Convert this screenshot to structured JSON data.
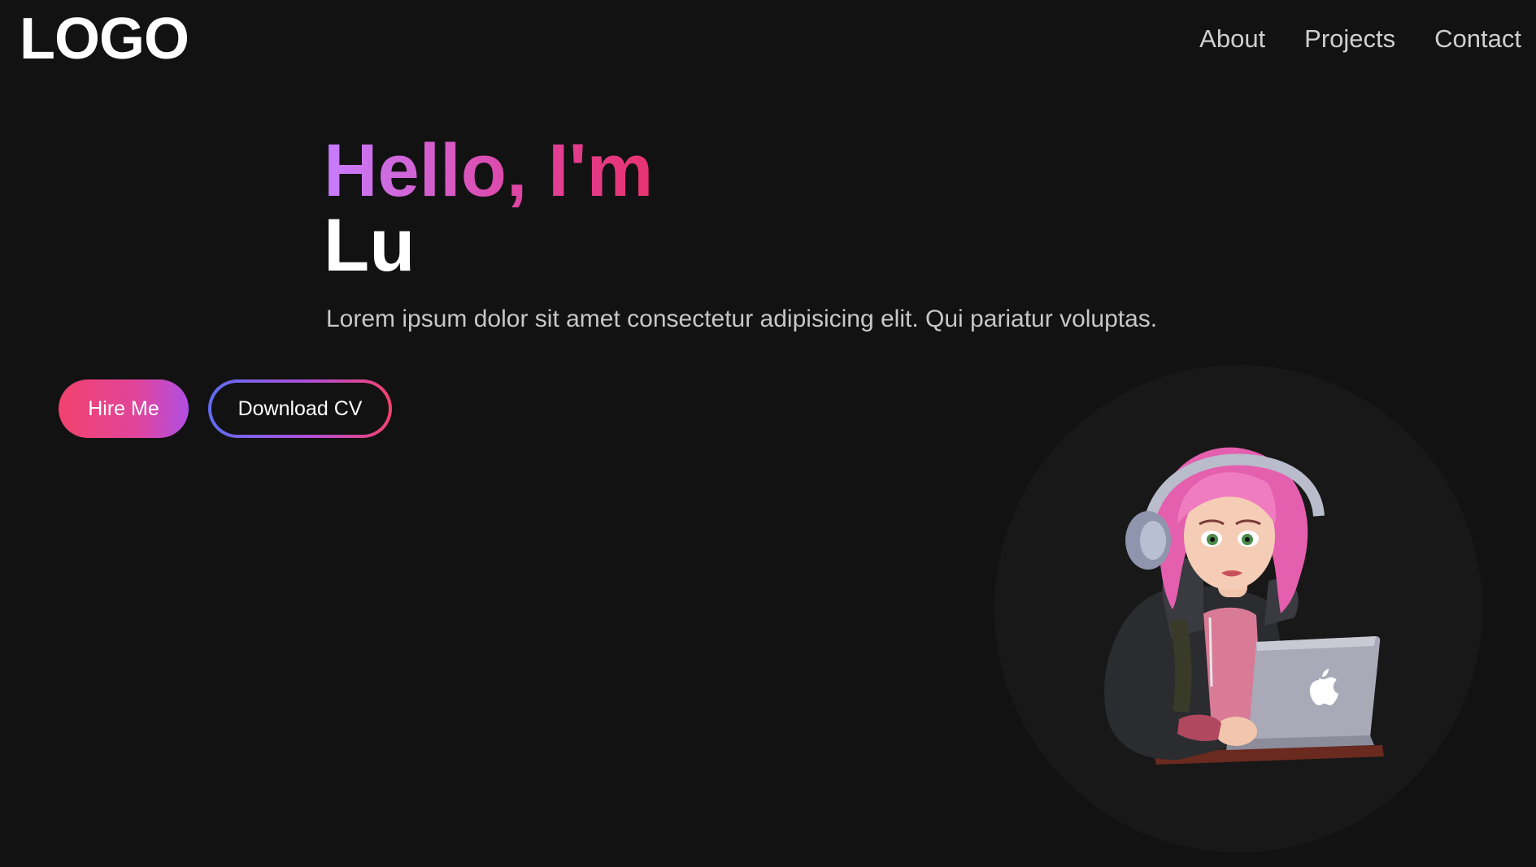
{
  "header": {
    "logo": "LOGO",
    "nav": [
      {
        "label": "About"
      },
      {
        "label": "Projects"
      },
      {
        "label": "Contact"
      }
    ]
  },
  "hero": {
    "greeting": "Hello, I'm",
    "name": "Lu",
    "description": "Lorem ipsum dolor sit amet consectetur adipisicing elit. Qui pariatur voluptas.",
    "buttons": {
      "hire": "Hire Me",
      "download_cv": "Download CV"
    }
  },
  "avatar": {
    "icon": "avatar-illustration",
    "laptop_icon": "apple-icon"
  },
  "colors": {
    "background": "#121212",
    "accent_pink": "#e8336f",
    "accent_purple": "#c77dff",
    "accent_blue": "#5f6cf2",
    "circle_bg": "#181818",
    "text_muted": "#c7c7c7"
  }
}
